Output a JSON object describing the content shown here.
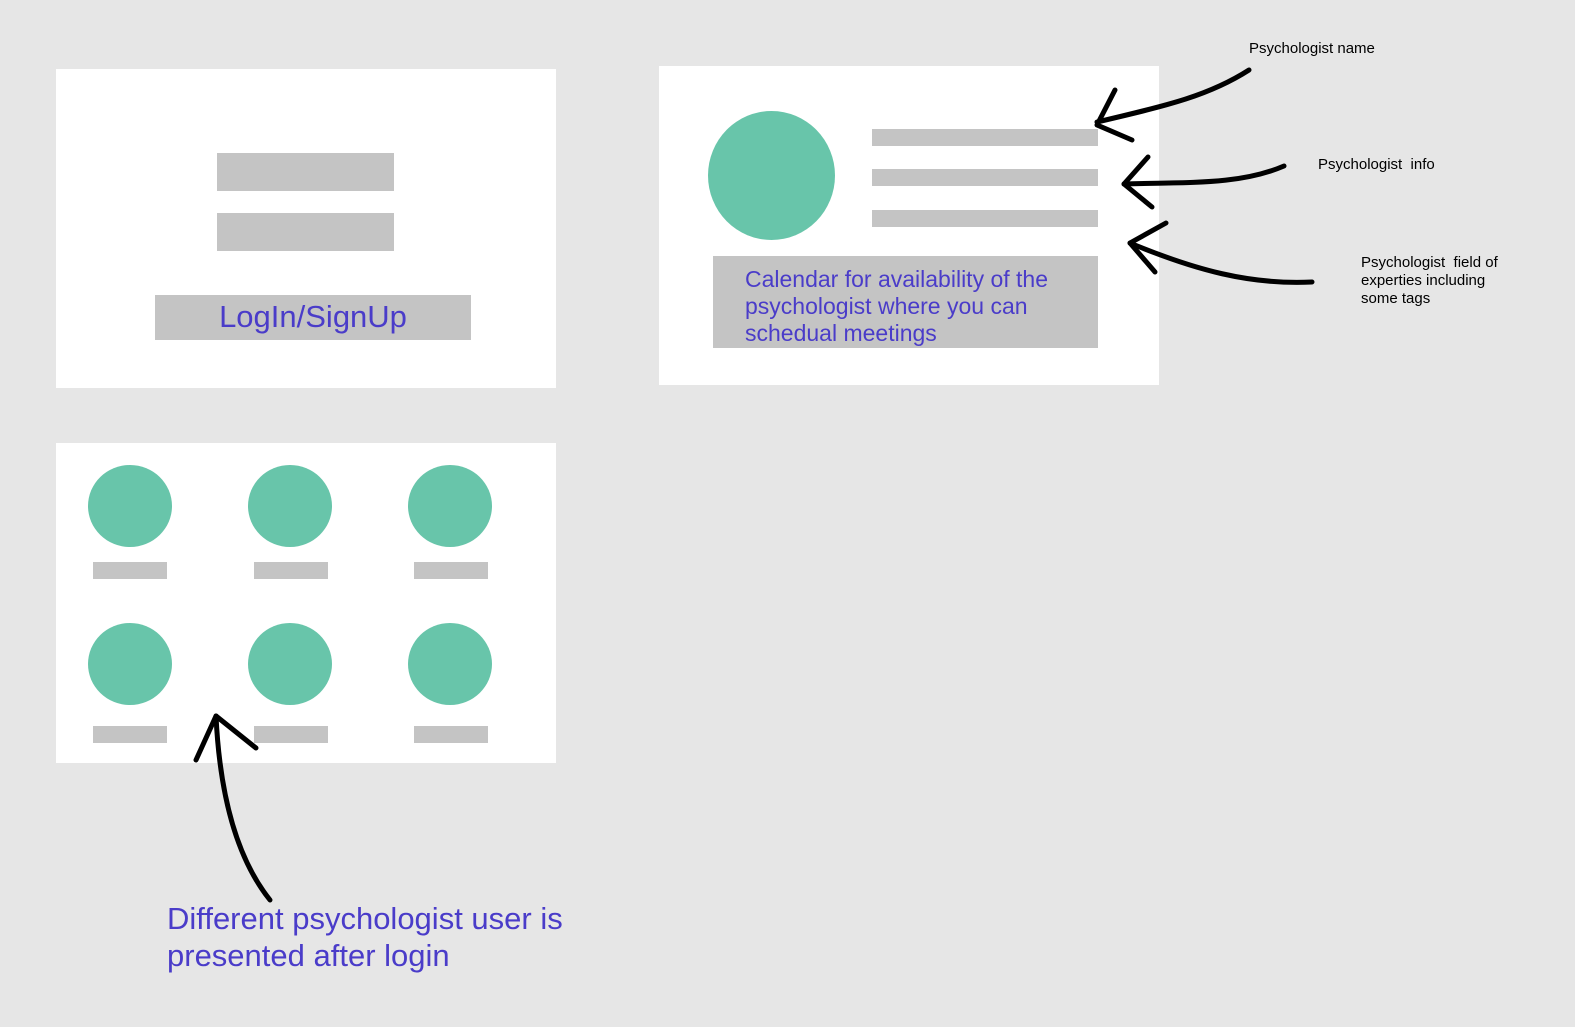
{
  "colors": {
    "background": "#e6e6e6",
    "panel": "#ffffff",
    "placeholder_bar": "#c4c4c4",
    "avatar": "#68c5aa",
    "accent_text": "#4a3cc9",
    "annotation": "#000000"
  },
  "login_panel": {
    "button_label": "LogIn/SignUp"
  },
  "profile_panel": {
    "calendar_text": "Calendar for availability of the psychologist where you can schedual meetings"
  },
  "annotations": {
    "name": "Psychologist name",
    "info": "Psychologist  info",
    "expertise": "Psychologist  field of experties including some tags"
  },
  "list_panel": {
    "caption": "Different psychologist user is presented after login"
  }
}
